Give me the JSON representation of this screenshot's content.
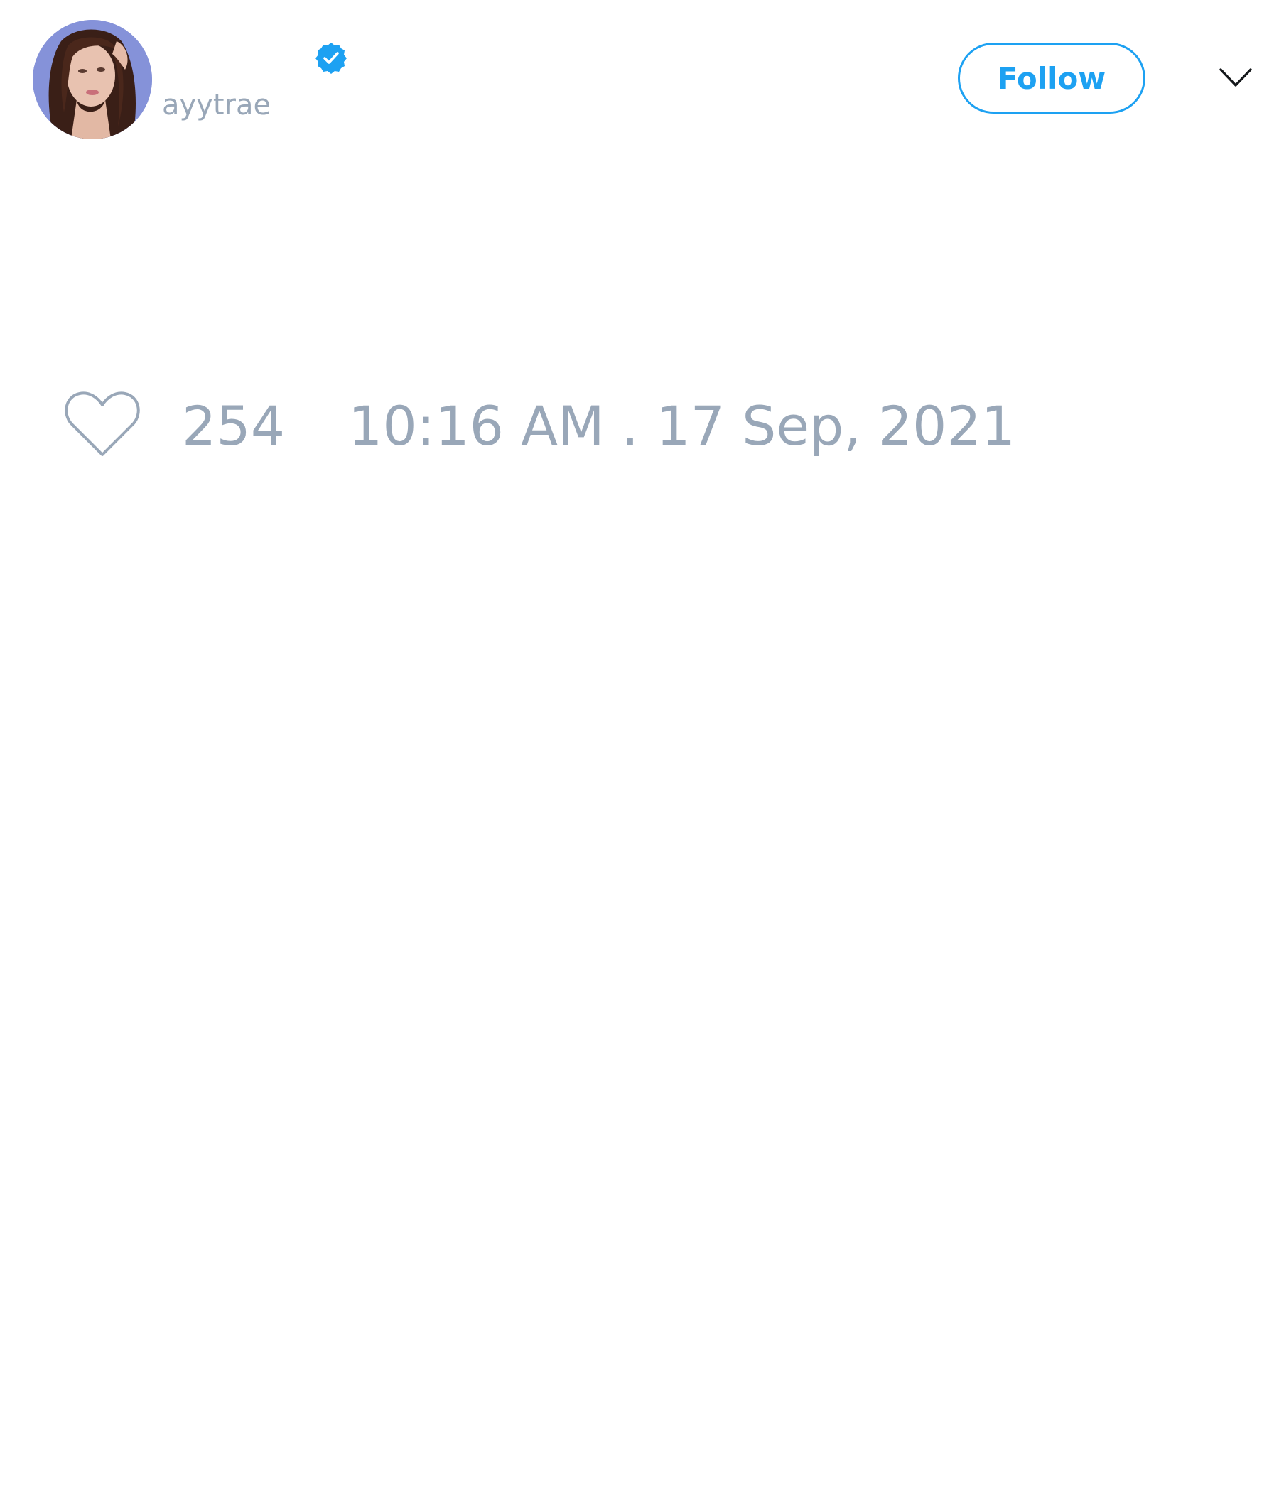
{
  "tweet": {
    "author": {
      "display_name": "",
      "handle": "ayytrae",
      "verified": true,
      "avatar_icon": "user-avatar-photo"
    },
    "follow_label": "Follow",
    "menu_icon": "chevron-down-icon",
    "like_icon": "heart-outline-icon",
    "like_count": "254",
    "timestamp": "10:16 AM . 17 Sep, 2021"
  },
  "colors": {
    "accent": "#1da1f2",
    "muted_text": "#99a7b8",
    "background": "#ffffff"
  }
}
